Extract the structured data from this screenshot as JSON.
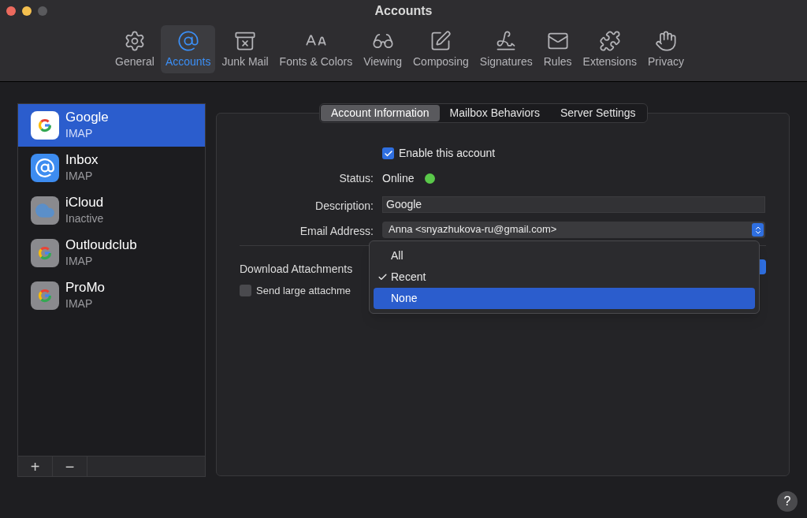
{
  "window": {
    "title": "Accounts"
  },
  "toolbar": [
    {
      "kind": "general",
      "label": "General",
      "selected": false
    },
    {
      "kind": "accounts",
      "label": "Accounts",
      "selected": true
    },
    {
      "kind": "junk",
      "label": "Junk Mail",
      "selected": false
    },
    {
      "kind": "fonts",
      "label": "Fonts & Colors",
      "selected": false
    },
    {
      "kind": "viewing",
      "label": "Viewing",
      "selected": false
    },
    {
      "kind": "composing",
      "label": "Composing",
      "selected": false
    },
    {
      "kind": "signatures",
      "label": "Signatures",
      "selected": false
    },
    {
      "kind": "rules",
      "label": "Rules",
      "selected": false
    },
    {
      "kind": "extensions",
      "label": "Extensions",
      "selected": false
    },
    {
      "kind": "privacy",
      "label": "Privacy",
      "selected": false
    }
  ],
  "accounts": [
    {
      "kind": "google",
      "name": "Google",
      "type": "IMAP",
      "selected": true
    },
    {
      "kind": "mail",
      "name": "Inbox",
      "type": "IMAP",
      "selected": false
    },
    {
      "kind": "icloud",
      "name": "iCloud",
      "type": "Inactive",
      "selected": false
    },
    {
      "kind": "google-grey",
      "name": "Outloudclub",
      "type": "IMAP",
      "selected": false
    },
    {
      "kind": "google-grey",
      "name": "ProMo",
      "type": "IMAP",
      "selected": false
    }
  ],
  "sidebar_buttons": [
    "+",
    "−"
  ],
  "tabs": [
    {
      "label": "Account Information",
      "selected": true
    },
    {
      "label": "Mailbox Behaviors",
      "selected": false
    },
    {
      "label": "Server Settings",
      "selected": false
    }
  ],
  "enable": {
    "label": "Enable this account",
    "checked": true
  },
  "status": {
    "label": "Status:",
    "value": "Online",
    "color": "#5ac84a"
  },
  "description": {
    "label": "Description:",
    "value": "Google"
  },
  "email": {
    "label": "Email Address:",
    "value": "Anna <snyazhukova-ru@gmail.com>"
  },
  "download": {
    "label": "Download Attachments"
  },
  "send_large": {
    "label": "Send large attachme",
    "checked": false
  },
  "menu": [
    {
      "label": "All",
      "checked": false,
      "selected": false
    },
    {
      "label": "Recent",
      "checked": true,
      "selected": false
    },
    {
      "label": "None",
      "checked": false,
      "selected": true
    }
  ],
  "help": "?"
}
